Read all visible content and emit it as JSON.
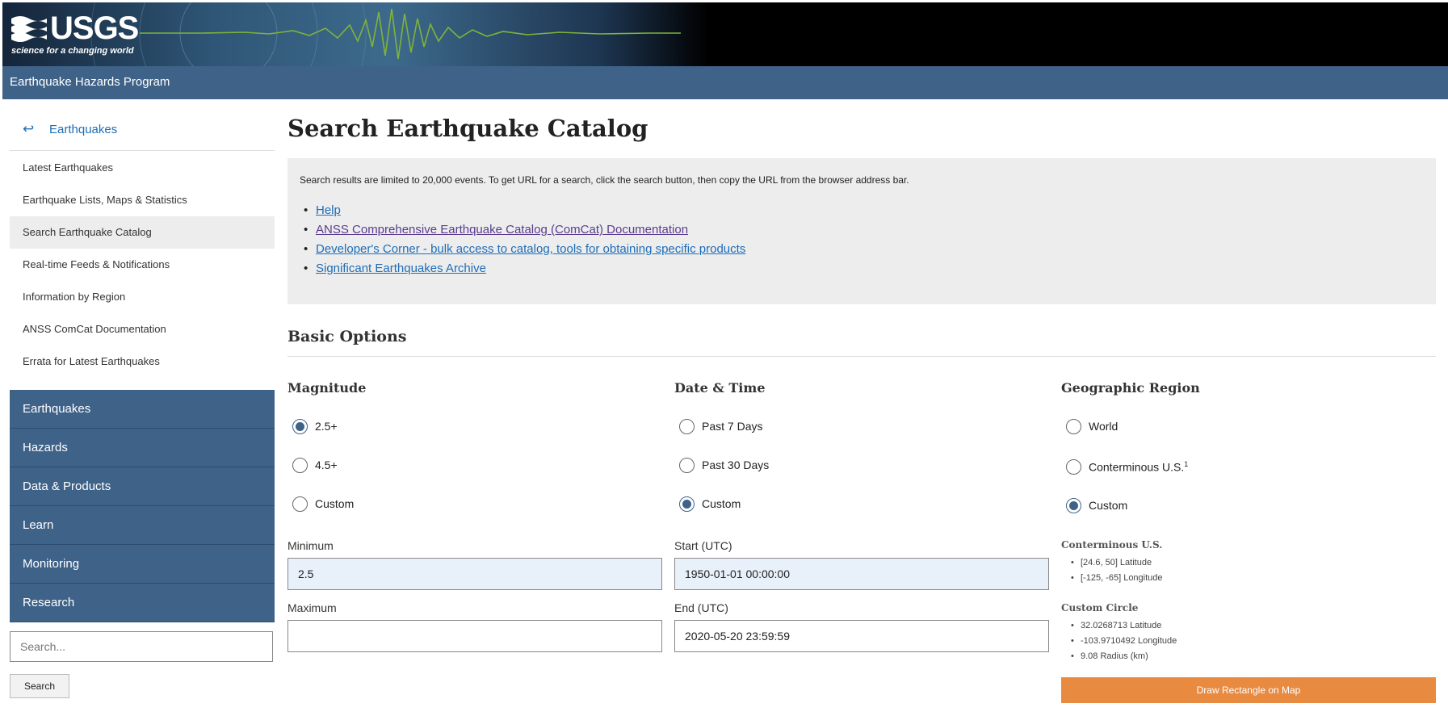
{
  "header": {
    "logo_text": "USGS",
    "logo_tagline": "science for a changing world",
    "program_title": "Earthquake Hazards Program"
  },
  "sidebar": {
    "back_icon": "arrow-left-icon",
    "back_label": "Earthquakes",
    "links": [
      {
        "label": "Latest Earthquakes",
        "active": false
      },
      {
        "label": "Earthquake Lists, Maps & Statistics",
        "active": false
      },
      {
        "label": "Search Earthquake Catalog",
        "active": true
      },
      {
        "label": "Real-time Feeds & Notifications",
        "active": false
      },
      {
        "label": "Information by Region",
        "active": false
      },
      {
        "label": "ANSS ComCat Documentation",
        "active": false
      },
      {
        "label": "Errata for Latest Earthquakes",
        "active": false
      }
    ],
    "nav": [
      "Earthquakes",
      "Hazards",
      "Data & Products",
      "Learn",
      "Monitoring",
      "Research"
    ],
    "search_placeholder": "Search...",
    "search_button": "Search"
  },
  "main": {
    "title": "Search Earthquake Catalog",
    "notice": "Search results are limited to 20,000 events. To get URL for a search, click the search button, then copy the URL from the browser address bar.",
    "links": [
      {
        "label": "Help",
        "visited": false
      },
      {
        "label": "ANSS Comprehensive Earthquake Catalog (ComCat) Documentation",
        "visited": true
      },
      {
        "label": "Developer's Corner - bulk access to catalog, tools for obtaining specific products",
        "visited": false
      },
      {
        "label": "Significant Earthquakes Archive",
        "visited": false
      }
    ],
    "basic_options_title": "Basic Options",
    "magnitude": {
      "title": "Magnitude",
      "options": [
        "2.5+",
        "4.5+",
        "Custom"
      ],
      "selected": "2.5+",
      "minimum_label": "Minimum",
      "minimum_value": "2.5",
      "maximum_label": "Maximum",
      "maximum_value": ""
    },
    "datetime": {
      "title": "Date & Time",
      "options": [
        "Past 7 Days",
        "Past 30 Days",
        "Custom"
      ],
      "selected": "Custom",
      "start_label": "Start (UTC)",
      "start_value": "1950-01-01 00:00:00",
      "end_label": "End (UTC)",
      "end_value": "2020-05-20 23:59:59"
    },
    "region": {
      "title": "Geographic Region",
      "options": [
        "World",
        "Conterminous U.S.",
        "Custom"
      ],
      "conterminous_footnote": "1",
      "selected": "Custom",
      "conterminous_heading": "Conterminous U.S.",
      "conterminous_items": [
        "[24.6, 50] Latitude",
        "[-125, -65] Longitude"
      ],
      "circle_heading": "Custom Circle",
      "circle_items": [
        "32.0268713 Latitude",
        "-103.9710492 Longitude",
        "9.08 Radius (km)"
      ],
      "map_button": "Draw Rectangle on Map"
    }
  },
  "colors": {
    "brand_blue": "#3f6288",
    "link_blue": "#1e6db7",
    "button_orange": "#e98a41"
  }
}
